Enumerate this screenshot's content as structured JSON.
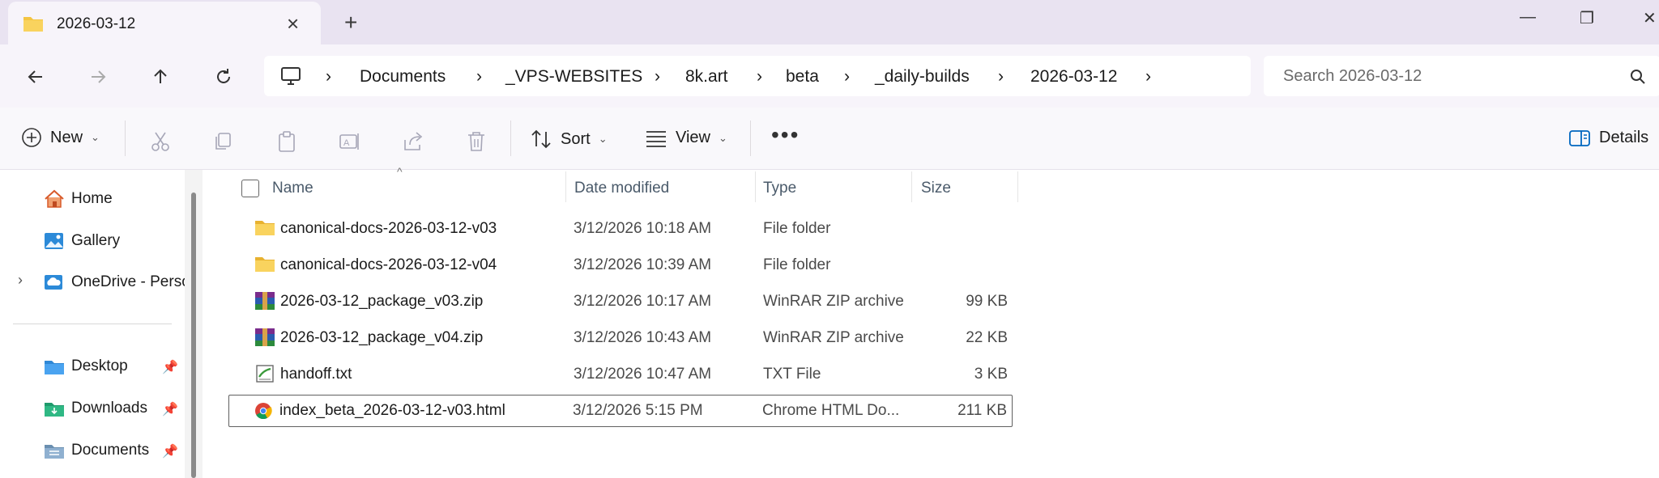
{
  "window": {
    "tab_title": "2026-03-12",
    "minimize": "—",
    "restore": "❐",
    "close": "✕"
  },
  "nav": {
    "breadcrumbs": [
      "Documents",
      "_VPS-WEBSITES",
      "8k.art",
      "beta",
      "_daily-builds",
      "2026-03-12"
    ],
    "search_placeholder": "Search 2026-03-12"
  },
  "commands": {
    "new_label": "New",
    "sort_label": "Sort",
    "view_label": "View",
    "details_label": "Details"
  },
  "sidebar": {
    "items": [
      {
        "label": "Home",
        "icon": "home-icon"
      },
      {
        "label": "Gallery",
        "icon": "gallery-icon"
      },
      {
        "label": "OneDrive - Perso",
        "icon": "cloud-icon"
      }
    ],
    "pinned": [
      {
        "label": "Desktop",
        "icon": "desktop-folder-icon"
      },
      {
        "label": "Downloads",
        "icon": "downloads-folder-icon"
      },
      {
        "label": "Documents",
        "icon": "documents-folder-icon"
      }
    ]
  },
  "columns": {
    "name": "Name",
    "date": "Date modified",
    "type": "Type",
    "size": "Size"
  },
  "files": [
    {
      "name": "canonical-docs-2026-03-12-v03",
      "date": "3/12/2026 10:18 AM",
      "type": "File folder",
      "size": "",
      "icon": "folder-icon"
    },
    {
      "name": "canonical-docs-2026-03-12-v04",
      "date": "3/12/2026 10:39 AM",
      "type": "File folder",
      "size": "",
      "icon": "folder-icon"
    },
    {
      "name": "2026-03-12_package_v03.zip",
      "date": "3/12/2026 10:17 AM",
      "type": "WinRAR ZIP archive",
      "size": "99 KB",
      "icon": "winrar-icon"
    },
    {
      "name": "2026-03-12_package_v04.zip",
      "date": "3/12/2026 10:43 AM",
      "type": "WinRAR ZIP archive",
      "size": "22 KB",
      "icon": "winrar-icon"
    },
    {
      "name": "handoff.txt",
      "date": "3/12/2026 10:47 AM",
      "type": "TXT File",
      "size": "3 KB",
      "icon": "text-file-icon"
    },
    {
      "name": "index_beta_2026-03-12-v03.html",
      "date": "3/12/2026 5:15 PM",
      "type": "Chrome HTML Do...",
      "size": "211 KB",
      "icon": "chrome-icon"
    }
  ],
  "colors": {
    "titlebar": "#e9e3f1",
    "navbar": "#f7f4fa",
    "accent": "#0067c0",
    "folder": "#f4c542"
  }
}
